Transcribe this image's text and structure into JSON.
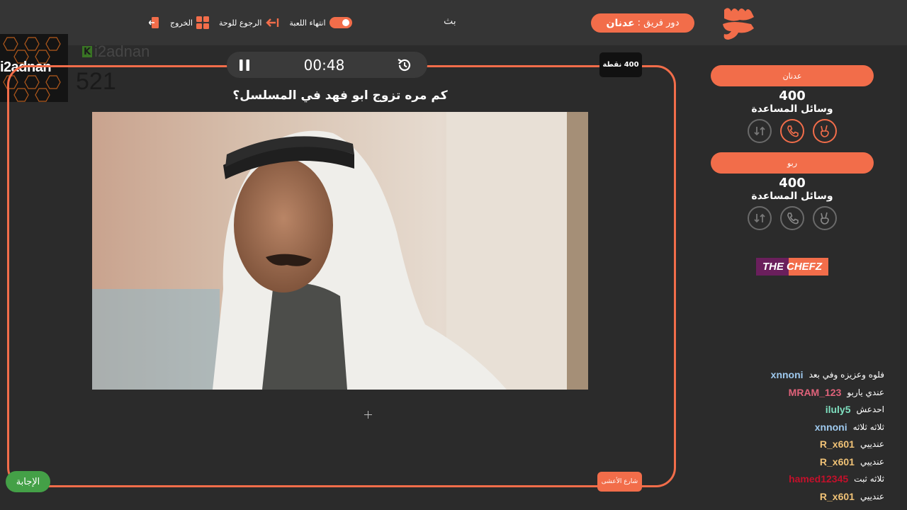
{
  "header": {
    "logo_text": "سين جيم",
    "turn_label": "دور فريق :",
    "turn_team": "عدنان",
    "center_text": "بث",
    "toolbar": [
      {
        "label": "انتهاء اللعبة",
        "icon": "toggle-icon"
      },
      {
        "label": "الرجوع للوحة",
        "icon": "arrow-back-icon"
      },
      {
        "label": "الخروج",
        "icon": "grid-icon"
      },
      {
        "label": "",
        "icon": "exit-icon"
      }
    ]
  },
  "streamer": {
    "name": "i2adnan",
    "kick_handle": "i2adnan",
    "viewer_count": "521"
  },
  "game": {
    "timer": "00:48",
    "points_badge": "400 نقطة",
    "question": "كم مره تزوج ابو فهد في المسلسل؟",
    "answer_label": "الإجابة",
    "bottom_button": "شارع الأعشى"
  },
  "teams": [
    {
      "name": "عدنان",
      "score": "400",
      "helps_label": "وسائل المساعدة",
      "helps": [
        {
          "icon": "peace-hand-icon",
          "active": true
        },
        {
          "icon": "phone-icon",
          "active": true
        },
        {
          "icon": "swap-icon",
          "active": false
        }
      ]
    },
    {
      "name": "ربو",
      "score": "400",
      "helps_label": "وسائل المساعدة",
      "helps": [
        {
          "icon": "peace-hand-icon",
          "active": false
        },
        {
          "icon": "phone-icon",
          "active": false
        },
        {
          "icon": "swap-icon",
          "active": false
        }
      ]
    }
  ],
  "sponsor": {
    "text_a": "THE",
    "text_b": "CHEFZ"
  },
  "chat": [
    {
      "user": "xnnoni",
      "color": "#9ec9ee",
      "message": "فلوه وعزيزه وفي بعد"
    },
    {
      "user": "MRAM_123",
      "color": "#e0627a",
      "message": "عندي ياربو"
    },
    {
      "user": "iluly5",
      "color": "#7fe0c0",
      "message": "احدعش"
    },
    {
      "user": "xnnoni",
      "color": "#9ec9ee",
      "message": "ثلاثه ثلاثه"
    },
    {
      "user": "R_x601",
      "color": "#f0c276",
      "message": "عندييي"
    },
    {
      "user": "R_x601",
      "color": "#f0c276",
      "message": "عندييي"
    },
    {
      "user": "hamed12345",
      "color": "#c4102b",
      "message": "ثلاثه ثبت"
    },
    {
      "user": "R_x601",
      "color": "#f0c276",
      "message": "عندييي"
    }
  ],
  "colors": {
    "accent": "#f26d4a",
    "answer": "#44a047",
    "background": "#2b2b2b"
  }
}
